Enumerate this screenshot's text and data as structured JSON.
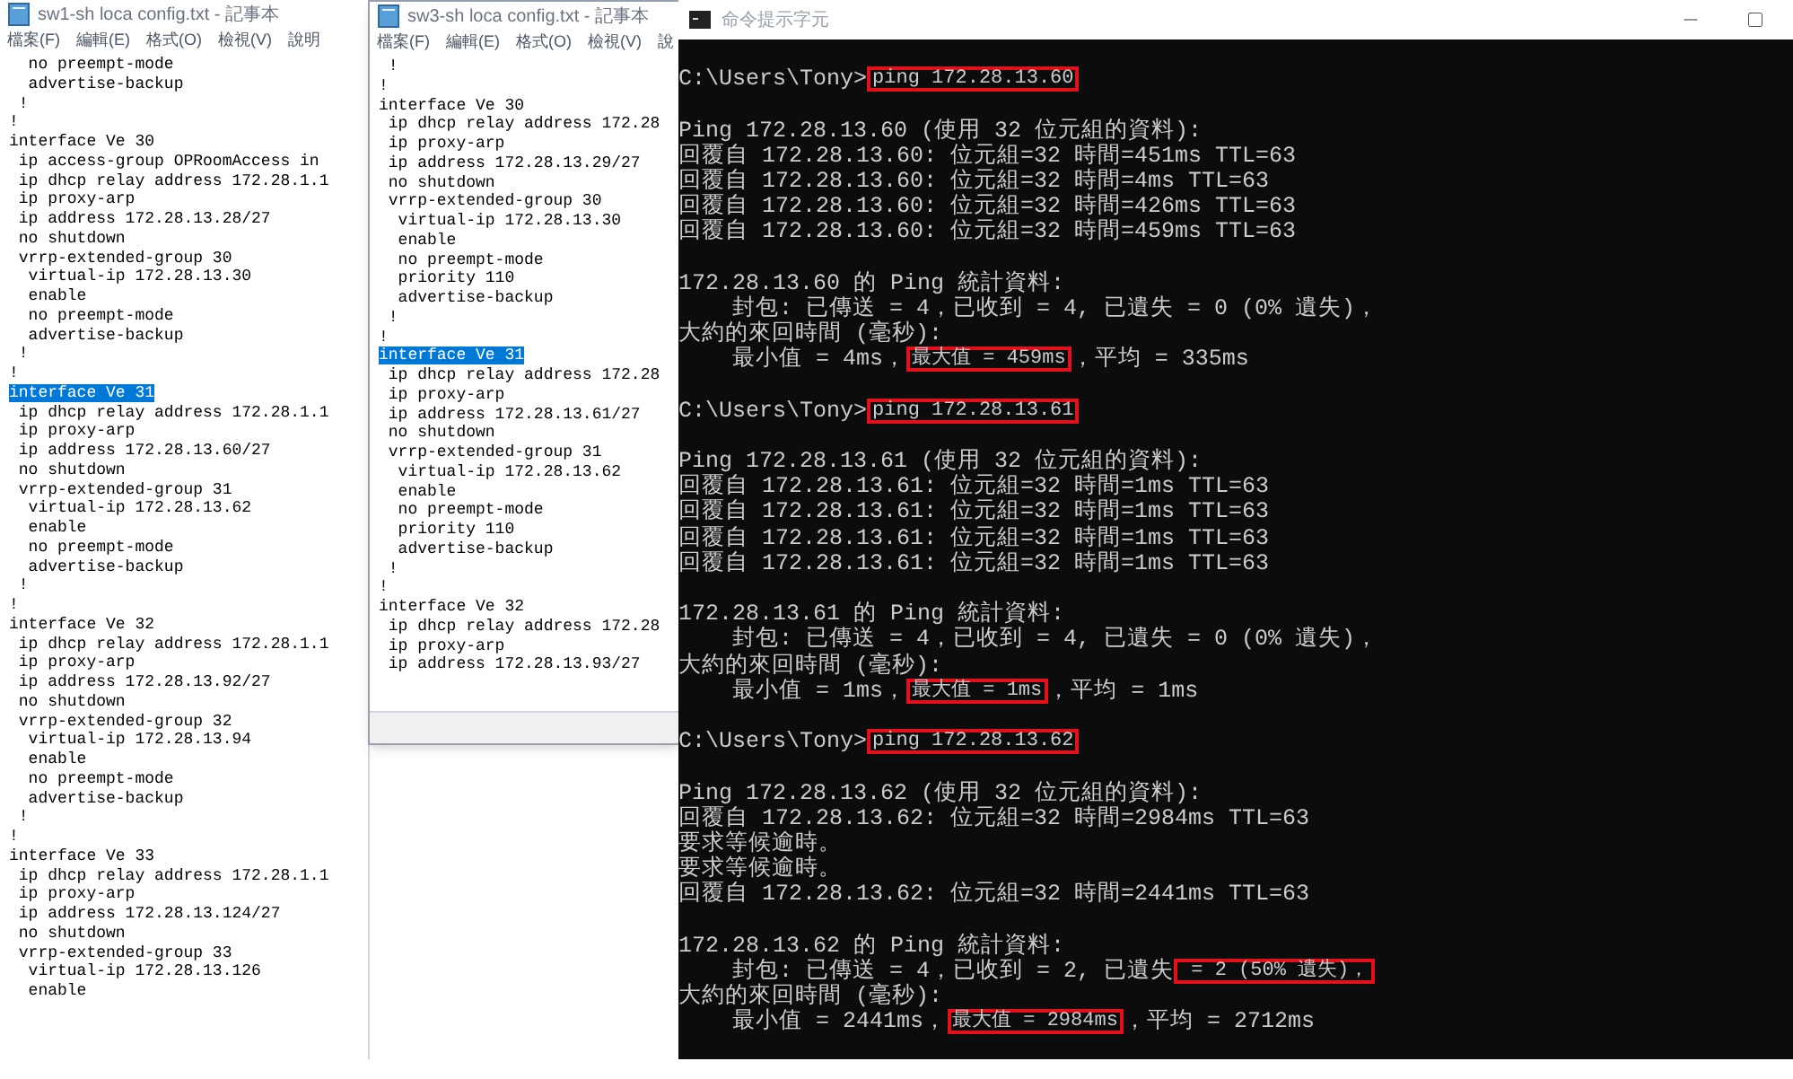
{
  "notepads": [
    {
      "title": "sw1-sh loca  config.txt - 記事本",
      "menu": [
        "檔案(F)",
        "編輯(E)",
        "格式(O)",
        "檢視(V)",
        "說明"
      ],
      "lines": [
        {
          "text": "  no preempt-mode",
          "selected": false
        },
        {
          "text": "  advertise-backup",
          "selected": false
        },
        {
          "text": " !",
          "selected": false
        },
        {
          "text": "!",
          "selected": false
        },
        {
          "text": "interface Ve 30",
          "selected": false
        },
        {
          "text": " ip access-group OPRoomAccess in",
          "selected": false
        },
        {
          "text": " ip dhcp relay address 172.28.1.1",
          "selected": false
        },
        {
          "text": " ip proxy-arp",
          "selected": false
        },
        {
          "text": " ip address 172.28.13.28/27",
          "selected": false
        },
        {
          "text": " no shutdown",
          "selected": false
        },
        {
          "text": " vrrp-extended-group 30",
          "selected": false
        },
        {
          "text": "  virtual-ip 172.28.13.30",
          "selected": false
        },
        {
          "text": "  enable",
          "selected": false
        },
        {
          "text": "  no preempt-mode",
          "selected": false
        },
        {
          "text": "  advertise-backup",
          "selected": false
        },
        {
          "text": " !",
          "selected": false
        },
        {
          "text": "!",
          "selected": false
        },
        {
          "text": "interface Ve 31",
          "selected": true
        },
        {
          "text": " ip dhcp relay address 172.28.1.1",
          "selected": false
        },
        {
          "text": " ip proxy-arp",
          "selected": false
        },
        {
          "text": " ip address 172.28.13.60/27",
          "selected": false
        },
        {
          "text": " no shutdown",
          "selected": false
        },
        {
          "text": " vrrp-extended-group 31",
          "selected": false
        },
        {
          "text": "  virtual-ip 172.28.13.62",
          "selected": false
        },
        {
          "text": "  enable",
          "selected": false
        },
        {
          "text": "  no preempt-mode",
          "selected": false
        },
        {
          "text": "  advertise-backup",
          "selected": false
        },
        {
          "text": " !",
          "selected": false
        },
        {
          "text": "!",
          "selected": false
        },
        {
          "text": "interface Ve 32",
          "selected": false
        },
        {
          "text": " ip dhcp relay address 172.28.1.1",
          "selected": false
        },
        {
          "text": " ip proxy-arp",
          "selected": false
        },
        {
          "text": " ip address 172.28.13.92/27",
          "selected": false
        },
        {
          "text": " no shutdown",
          "selected": false
        },
        {
          "text": " vrrp-extended-group 32",
          "selected": false
        },
        {
          "text": "  virtual-ip 172.28.13.94",
          "selected": false
        },
        {
          "text": "  enable",
          "selected": false
        },
        {
          "text": "  no preempt-mode",
          "selected": false
        },
        {
          "text": "  advertise-backup",
          "selected": false
        },
        {
          "text": " !",
          "selected": false
        },
        {
          "text": "!",
          "selected": false
        },
        {
          "text": "interface Ve 33",
          "selected": false
        },
        {
          "text": " ip dhcp relay address 172.28.1.1",
          "selected": false
        },
        {
          "text": " ip proxy-arp",
          "selected": false
        },
        {
          "text": " ip address 172.28.13.124/27",
          "selected": false
        },
        {
          "text": " no shutdown",
          "selected": false
        },
        {
          "text": " vrrp-extended-group 33",
          "selected": false
        },
        {
          "text": "  virtual-ip 172.28.13.126",
          "selected": false
        },
        {
          "text": "  enable",
          "selected": false
        }
      ]
    },
    {
      "title": "sw3-sh loca  config.txt - 記事本",
      "menu": [
        "檔案(F)",
        "編輯(E)",
        "格式(O)",
        "檢視(V)",
        "說"
      ],
      "lines": [
        {
          "text": " !",
          "selected": false
        },
        {
          "text": "!",
          "selected": false
        },
        {
          "text": "interface Ve 30",
          "selected": false
        },
        {
          "text": " ip dhcp relay address 172.28",
          "selected": false
        },
        {
          "text": " ip proxy-arp",
          "selected": false
        },
        {
          "text": " ip address 172.28.13.29/27",
          "selected": false
        },
        {
          "text": " no shutdown",
          "selected": false
        },
        {
          "text": " vrrp-extended-group 30",
          "selected": false
        },
        {
          "text": "  virtual-ip 172.28.13.30",
          "selected": false
        },
        {
          "text": "  enable",
          "selected": false
        },
        {
          "text": "  no preempt-mode",
          "selected": false
        },
        {
          "text": "  priority 110",
          "selected": false
        },
        {
          "text": "  advertise-backup",
          "selected": false
        },
        {
          "text": " !",
          "selected": false
        },
        {
          "text": "!",
          "selected": false
        },
        {
          "text": "interface Ve 31",
          "selected": true
        },
        {
          "text": " ip dhcp relay address 172.28",
          "selected": false
        },
        {
          "text": " ip proxy-arp",
          "selected": false
        },
        {
          "text": " ip address 172.28.13.61/27",
          "selected": false
        },
        {
          "text": " no shutdown",
          "selected": false
        },
        {
          "text": " vrrp-extended-group 31",
          "selected": false
        },
        {
          "text": "  virtual-ip 172.28.13.62",
          "selected": false
        },
        {
          "text": "  enable",
          "selected": false
        },
        {
          "text": "  no preempt-mode",
          "selected": false
        },
        {
          "text": "  priority 110",
          "selected": false
        },
        {
          "text": "  advertise-backup",
          "selected": false
        },
        {
          "text": " !",
          "selected": false
        },
        {
          "text": "!",
          "selected": false
        },
        {
          "text": "interface Ve 32",
          "selected": false
        },
        {
          "text": " ip dhcp relay address 172.28",
          "selected": false
        },
        {
          "text": " ip proxy-arp",
          "selected": false
        },
        {
          "text": " ip address 172.28.13.93/27",
          "selected": false
        }
      ]
    }
  ],
  "console": {
    "title": "命令提示字元",
    "lines": [
      {
        "space_before": true,
        "segments": [
          {
            "text": "C:\\Users\\Tony>",
            "boxed": false
          },
          {
            "text": "ping 172.28.13.60",
            "boxed": true
          }
        ]
      },
      {
        "space_before": true,
        "segments": [
          {
            "text": "Ping 172.28.13.60 (使用 32 位元組的資料):",
            "boxed": false
          }
        ]
      },
      {
        "space_before": false,
        "segments": [
          {
            "text": "回覆自 172.28.13.60: 位元組=32 時間=451ms TTL=63",
            "boxed": false
          }
        ]
      },
      {
        "space_before": false,
        "segments": [
          {
            "text": "回覆自 172.28.13.60: 位元組=32 時間=4ms TTL=63",
            "boxed": false
          }
        ]
      },
      {
        "space_before": false,
        "segments": [
          {
            "text": "回覆自 172.28.13.60: 位元組=32 時間=426ms TTL=63",
            "boxed": false
          }
        ]
      },
      {
        "space_before": false,
        "segments": [
          {
            "text": "回覆自 172.28.13.60: 位元組=32 時間=459ms TTL=63",
            "boxed": false
          }
        ]
      },
      {
        "space_before": true,
        "segments": [
          {
            "text": "172.28.13.60 的 Ping 統計資料:",
            "boxed": false
          }
        ]
      },
      {
        "space_before": false,
        "segments": [
          {
            "text": "    封包: 已傳送 = 4，已收到 = 4, 已遺失 = 0 (0% 遺失)，",
            "boxed": false
          }
        ]
      },
      {
        "space_before": false,
        "segments": [
          {
            "text": "大約的來回時間 (毫秒):",
            "boxed": false
          }
        ]
      },
      {
        "space_before": false,
        "segments": [
          {
            "text": "    最小值 = 4ms，",
            "boxed": false
          },
          {
            "text": "最大值 = 459ms",
            "boxed": true
          },
          {
            "text": "，平均 = 335ms",
            "boxed": false
          }
        ]
      },
      {
        "space_before": true,
        "segments": [
          {
            "text": "C:\\Users\\Tony>",
            "boxed": false
          },
          {
            "text": "ping 172.28.13.61",
            "boxed": true
          }
        ]
      },
      {
        "space_before": true,
        "segments": [
          {
            "text": "Ping 172.28.13.61 (使用 32 位元組的資料):",
            "boxed": false
          }
        ]
      },
      {
        "space_before": false,
        "segments": [
          {
            "text": "回覆自 172.28.13.61: 位元組=32 時間=1ms TTL=63",
            "boxed": false
          }
        ]
      },
      {
        "space_before": false,
        "segments": [
          {
            "text": "回覆自 172.28.13.61: 位元組=32 時間=1ms TTL=63",
            "boxed": false
          }
        ]
      },
      {
        "space_before": false,
        "segments": [
          {
            "text": "回覆自 172.28.13.61: 位元組=32 時間=1ms TTL=63",
            "boxed": false
          }
        ]
      },
      {
        "space_before": false,
        "segments": [
          {
            "text": "回覆自 172.28.13.61: 位元組=32 時間=1ms TTL=63",
            "boxed": false
          }
        ]
      },
      {
        "space_before": true,
        "segments": [
          {
            "text": "172.28.13.61 的 Ping 統計資料:",
            "boxed": false
          }
        ]
      },
      {
        "space_before": false,
        "segments": [
          {
            "text": "    封包: 已傳送 = 4，已收到 = 4, 已遺失 = 0 (0% 遺失)，",
            "boxed": false
          }
        ]
      },
      {
        "space_before": false,
        "segments": [
          {
            "text": "大約的來回時間 (毫秒):",
            "boxed": false
          }
        ]
      },
      {
        "space_before": false,
        "segments": [
          {
            "text": "    最小值 = 1ms，",
            "boxed": false
          },
          {
            "text": "最大值 = 1ms",
            "boxed": true
          },
          {
            "text": "，平均 = 1ms",
            "boxed": false
          }
        ]
      },
      {
        "space_before": true,
        "segments": [
          {
            "text": "C:\\Users\\Tony>",
            "boxed": false
          },
          {
            "text": "ping 172.28.13.62",
            "boxed": true
          }
        ]
      },
      {
        "space_before": true,
        "segments": [
          {
            "text": "Ping 172.28.13.62 (使用 32 位元組的資料):",
            "boxed": false
          }
        ]
      },
      {
        "space_before": false,
        "segments": [
          {
            "text": "回覆自 172.28.13.62: 位元組=32 時間=2984ms TTL=63",
            "boxed": false
          }
        ]
      },
      {
        "space_before": false,
        "segments": [
          {
            "text": "要求等候逾時。",
            "boxed": false
          }
        ]
      },
      {
        "space_before": false,
        "segments": [
          {
            "text": "要求等候逾時。",
            "boxed": false
          }
        ]
      },
      {
        "space_before": false,
        "segments": [
          {
            "text": "回覆自 172.28.13.62: 位元組=32 時間=2441ms TTL=63",
            "boxed": false
          }
        ]
      },
      {
        "space_before": true,
        "segments": [
          {
            "text": "172.28.13.62 的 Ping 統計資料:",
            "boxed": false
          }
        ]
      },
      {
        "space_before": false,
        "segments": [
          {
            "text": "    封包: 已傳送 = 4，已收到 = 2, 已遺失",
            "boxed": false
          },
          {
            "text": " = 2 (50% 遺失)，",
            "boxed": true
          }
        ]
      },
      {
        "space_before": false,
        "segments": [
          {
            "text": "大約的來回時間 (毫秒):",
            "boxed": false
          }
        ]
      },
      {
        "space_before": false,
        "segments": [
          {
            "text": "    最小值 = 2441ms，",
            "boxed": false
          },
          {
            "text": "最大值 = 2984ms",
            "boxed": true
          },
          {
            "text": "，平均 = 2712ms",
            "boxed": false
          }
        ]
      }
    ]
  }
}
